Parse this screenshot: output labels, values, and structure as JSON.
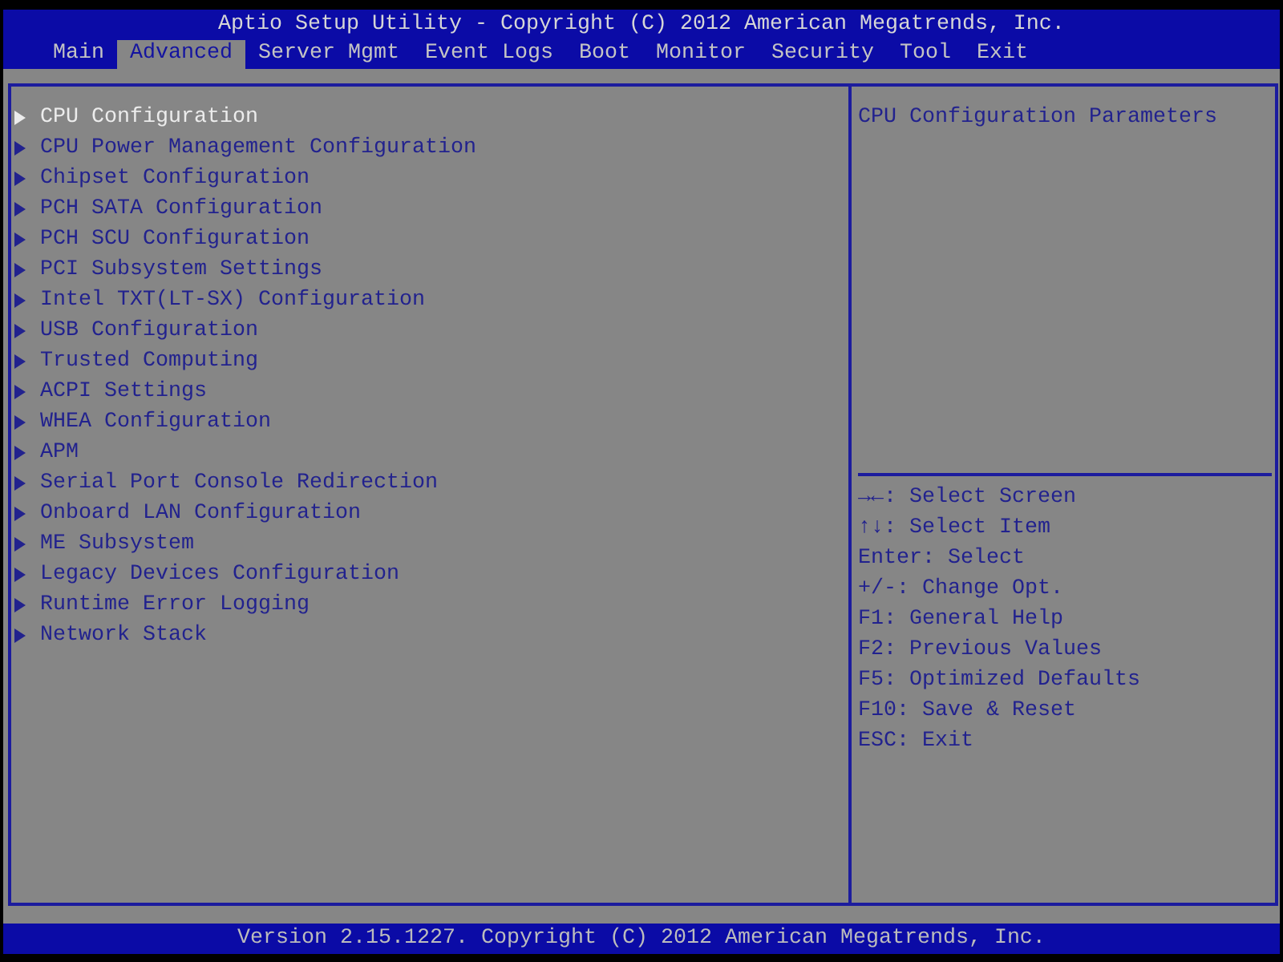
{
  "window": {
    "title": "Aptio Setup Utility - Copyright (C) 2012 American Megatrends, Inc."
  },
  "tabs": [
    {
      "label": "Main",
      "selected": false
    },
    {
      "label": "Advanced",
      "selected": true
    },
    {
      "label": "Server Mgmt",
      "selected": false
    },
    {
      "label": "Event Logs",
      "selected": false
    },
    {
      "label": "Boot",
      "selected": false
    },
    {
      "label": "Monitor",
      "selected": false
    },
    {
      "label": "Security",
      "selected": false
    },
    {
      "label": "Tool",
      "selected": false
    },
    {
      "label": "Exit",
      "selected": false
    }
  ],
  "menu_items": [
    {
      "label": "CPU Configuration",
      "selected": true
    },
    {
      "label": "CPU Power Management Configuration",
      "selected": false
    },
    {
      "label": "Chipset Configuration",
      "selected": false
    },
    {
      "label": "PCH SATA Configuration",
      "selected": false
    },
    {
      "label": "PCH SCU Configuration",
      "selected": false
    },
    {
      "label": "PCI Subsystem Settings",
      "selected": false
    },
    {
      "label": "Intel TXT(LT-SX) Configuration",
      "selected": false
    },
    {
      "label": "USB Configuration",
      "selected": false
    },
    {
      "label": "Trusted Computing",
      "selected": false
    },
    {
      "label": "ACPI Settings",
      "selected": false
    },
    {
      "label": "WHEA Configuration",
      "selected": false
    },
    {
      "label": "APM",
      "selected": false
    },
    {
      "label": "Serial Port Console Redirection",
      "selected": false
    },
    {
      "label": "Onboard LAN Configuration",
      "selected": false
    },
    {
      "label": "ME Subsystem",
      "selected": false
    },
    {
      "label": "Legacy Devices Configuration",
      "selected": false
    },
    {
      "label": "Runtime Error Logging",
      "selected": false
    },
    {
      "label": "Network Stack",
      "selected": false
    }
  ],
  "help_panel": {
    "description": "CPU Configuration Parameters",
    "key_help": [
      "→←: Select Screen",
      "↑↓: Select Item",
      "Enter: Select",
      "+/-: Change Opt.",
      "F1: General Help",
      "F2: Previous Values",
      "F5: Optimized Defaults",
      "F10: Save & Reset",
      "ESC: Exit"
    ]
  },
  "status_bar": {
    "text": "Version 2.15.1227. Copyright (C) 2012 American Megatrends, Inc."
  }
}
